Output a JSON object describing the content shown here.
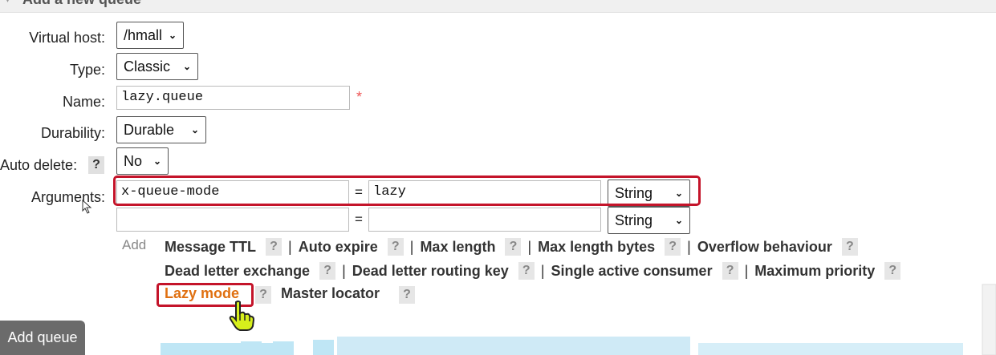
{
  "section": {
    "title": "Add a new queue"
  },
  "form": {
    "vhost": {
      "label": "Virtual host:",
      "value": "/hmall"
    },
    "type": {
      "label": "Type:",
      "value": "Classic"
    },
    "name": {
      "label": "Name:",
      "value": "lazy.queue",
      "required_mark": "*"
    },
    "durability": {
      "label": "Durability:",
      "value": "Durable"
    },
    "auto_delete": {
      "label": "Auto delete:",
      "value": "No",
      "help": "?"
    },
    "arguments": {
      "label": "Arguments:",
      "rows": [
        {
          "key": "x-queue-mode",
          "eq": "=",
          "value": "lazy",
          "type": "String"
        },
        {
          "key": "",
          "eq": "=",
          "value": "",
          "type": "String"
        }
      ],
      "add_label": "Add",
      "presets_row1": [
        "Message TTL",
        "Auto expire",
        "Max length",
        "Max length bytes",
        "Overflow behaviour"
      ],
      "presets_row2": [
        "Dead letter exchange",
        "Dead letter routing key",
        "Single active consumer",
        "Maximum priority"
      ],
      "presets_row3": [
        "Lazy mode",
        "Master locator"
      ],
      "separator": "|",
      "help": "?"
    }
  },
  "add_button": {
    "label": "Add queue"
  },
  "colors": {
    "highlight": "#c4142a",
    "lazy_link": "#e07011",
    "button_bg": "#6b6b6b",
    "decor": "#bfe6f5"
  },
  "icons": {
    "pointer": "hand-pointer-icon",
    "arrow": "mouse-arrow-icon",
    "triangle": "collapse-triangle-icon"
  }
}
